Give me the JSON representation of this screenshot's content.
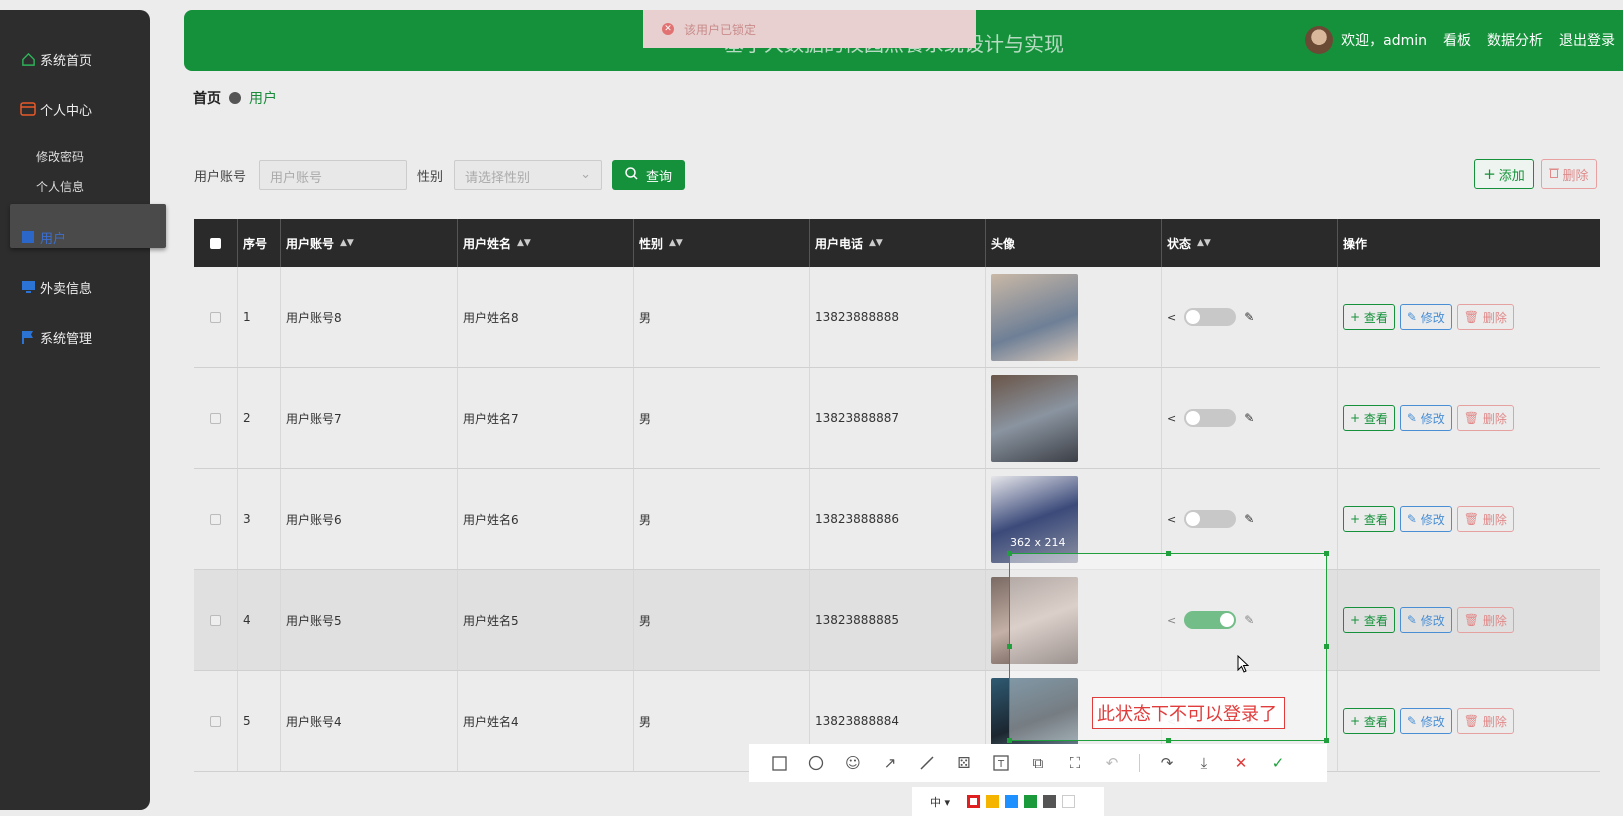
{
  "sidebar": {
    "items": [
      {
        "label": "系统首页",
        "icon": "home-icon"
      },
      {
        "label": "个人中心",
        "icon": "wallet-icon"
      },
      {
        "label": "修改密码"
      },
      {
        "label": "个人信息"
      },
      {
        "label": "用户",
        "icon": "user-icon"
      },
      {
        "label": "外卖信息",
        "icon": "monitor-icon"
      },
      {
        "label": "系统管理",
        "icon": "flag-icon"
      }
    ]
  },
  "header": {
    "title": "基于大数据的校园点餐系统设计与实现",
    "welcome": "欢迎，admin",
    "links": [
      "看板",
      "数据分析",
      "退出登录"
    ]
  },
  "toast": {
    "message": "该用户已锁定"
  },
  "breadcrumb": {
    "home": "首页",
    "current": "用户"
  },
  "search": {
    "account_label": "用户账号",
    "account_placeholder": "用户账号",
    "gender_label": "性别",
    "gender_placeholder": "请选择性别",
    "query_label": "查询",
    "add_label": "添加",
    "delete_label": "删除"
  },
  "table": {
    "headers": [
      "序号",
      "用户账号",
      "用户姓名",
      "性别",
      "用户电话",
      "头像",
      "状态",
      "操作"
    ],
    "rows": [
      {
        "no": "1",
        "account": "用户账号8",
        "name": "用户姓名8",
        "gender": "男",
        "phone": "13823888888",
        "status_on": false
      },
      {
        "no": "2",
        "account": "用户账号7",
        "name": "用户姓名7",
        "gender": "男",
        "phone": "13823888887",
        "status_on": false
      },
      {
        "no": "3",
        "account": "用户账号6",
        "name": "用户姓名6",
        "gender": "男",
        "phone": "13823888886",
        "status_on": false
      },
      {
        "no": "4",
        "account": "用户账号5",
        "name": "用户姓名5",
        "gender": "男",
        "phone": "13823888885",
        "status_on": true
      },
      {
        "no": "5",
        "account": "用户账号4",
        "name": "用户姓名4",
        "gender": "男",
        "phone": "13823888884",
        "status_on": false
      }
    ],
    "ops": {
      "view": "查看",
      "edit": "修改",
      "delete": "删除"
    }
  },
  "overlay": {
    "dimensions": "362 x 214",
    "annotation": "此状态下不可以登录了",
    "size_option": "中",
    "colors": [
      "#e02020",
      "#f5b400",
      "#1e90ff",
      "#1a9a3a",
      "#555555",
      "#ffffff"
    ]
  }
}
